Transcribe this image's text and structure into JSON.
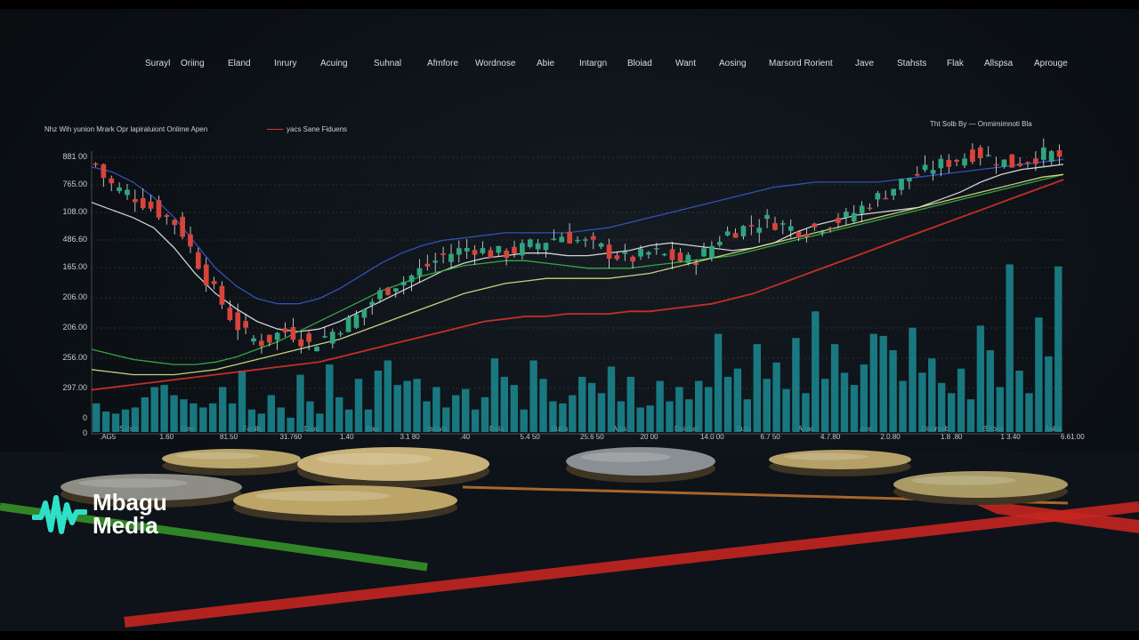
{
  "menu": [
    "Surayl",
    "Oriing",
    "Eland",
    "Inrury",
    "Acuing",
    "Suhnal",
    "Afmfore",
    "Wordnose",
    "Abie",
    "Intargn",
    "Bloiad",
    "Want",
    "Aosing",
    "Marsord Rorient",
    "Jave",
    "Stahsts",
    "Flak",
    "Allspsa",
    "Aprouge"
  ],
  "legend": {
    "left": "Nhz Wih yunion Mrark Opr lapiraluiont Onlime Apen",
    "mid": "yacs Sane Fiduens",
    "right": "Tht Solb By — Onmimimnoti Bla"
  },
  "brand": {
    "line1": "Mbagu",
    "line2": "Media"
  },
  "colors": {
    "background": "#0c1116",
    "up": "#2fa57e",
    "down": "#d8433a",
    "volume": "#1b8a92",
    "ma_white": "#e6e6e6",
    "ma_green": "#3db54a",
    "ma_yellow": "#d9e68a",
    "ma_red": "#d8322a",
    "ma_blue": "#3a56c8",
    "brand": "#2ee0c8"
  },
  "chart_data": {
    "type": "candlestick",
    "title": "",
    "xlabel": "",
    "ylabel": "",
    "y_ticks": [
      "881 00",
      "765.00",
      "108.00",
      "486.60",
      "165.00",
      "206.00",
      "206.00",
      "256.00",
      "297.00",
      "0",
      "0"
    ],
    "x_ticks": [
      ".AG5",
      "1.60",
      "81.50",
      "31.760",
      "1.40",
      "3.1 80",
      ".40",
      "5.4 50",
      "25.6 50",
      "20 00",
      "14.0 00",
      "6.7 50",
      "4.7.80",
      "2.0.80",
      "1.8 .80",
      "1 3.40",
      "6.61.00"
    ],
    "x_ticks_secondary": [
      "Salsts",
      "Gee",
      "Fanils",
      "Daal",
      "Baa",
      "Isswis",
      "Dala",
      "Bullis",
      "Adis",
      "Doisbal",
      "Bulls",
      "Anas",
      "Ans",
      "Dissrsab",
      "Billbas",
      "Anlos"
    ],
    "grid": true,
    "legend_position": "top-left",
    "price_range": [
      0,
      100
    ],
    "close": [
      93,
      88,
      85,
      83,
      82,
      80,
      78,
      76,
      74,
      72,
      70,
      66,
      60,
      54,
      48,
      43,
      38,
      33,
      29,
      26,
      24,
      23,
      24,
      26,
      27,
      26,
      24,
      22,
      23,
      25,
      27,
      29,
      31,
      33,
      36,
      39,
      42,
      44,
      46,
      47,
      49,
      51,
      53,
      55,
      57,
      58,
      59,
      60,
      60,
      59,
      58,
      58,
      58,
      59,
      60,
      61,
      62,
      63,
      64,
      65,
      64,
      63,
      62,
      61,
      60,
      58,
      57,
      56,
      56,
      57,
      58,
      58,
      57,
      56,
      55,
      55,
      56,
      58,
      61,
      64,
      66,
      67,
      68,
      69,
      70,
      71,
      70,
      69,
      68,
      67,
      67,
      68,
      69,
      70,
      71,
      72,
      74,
      76,
      78,
      80,
      82,
      84,
      86,
      88,
      89,
      90,
      92,
      93,
      94,
      95,
      96,
      97,
      97,
      96,
      95,
      94,
      93,
      94,
      95,
      96,
      97,
      97,
      96
    ],
    "series": [
      {
        "values": [
          78,
          75,
          72,
          68,
          60,
          50,
          42,
          36,
          31,
          28,
          27,
          28,
          31,
          35,
          39,
          43,
          47,
          51,
          54,
          56,
          57,
          58,
          58,
          57,
          57,
          58,
          59,
          61,
          62,
          61,
          60,
          59,
          60,
          62,
          66,
          69,
          71,
          73,
          74,
          75,
          76,
          79,
          82,
          86,
          89,
          91,
          92,
          93
        ]
      },
      {
        "values": [
          20,
          18,
          16,
          15,
          14,
          14,
          15,
          17,
          20,
          23,
          27,
          31,
          35,
          39,
          43,
          46,
          49,
          51,
          53,
          54,
          55,
          55,
          54,
          53,
          52,
          52,
          52,
          53,
          54,
          55,
          56,
          57,
          59,
          61,
          63,
          65,
          67,
          69,
          71,
          73,
          75,
          77,
          79,
          81,
          83,
          85,
          87,
          89
        ]
      },
      {
        "values": [
          12,
          11,
          10,
          10,
          10,
          11,
          12,
          14,
          16,
          18,
          20,
          22,
          24,
          27,
          30,
          33,
          36,
          39,
          42,
          44,
          46,
          47,
          48,
          48,
          48,
          48,
          49,
          50,
          52,
          54,
          56,
          58,
          60,
          62,
          64,
          66,
          68,
          70,
          72,
          74,
          76,
          78,
          80,
          82,
          84,
          86,
          88,
          89
        ]
      },
      {
        "values": [
          4,
          5,
          6,
          7,
          8,
          9,
          10,
          11,
          12,
          13,
          14,
          15,
          17,
          19,
          21,
          23,
          25,
          27,
          29,
          31,
          32,
          33,
          33,
          34,
          34,
          34,
          35,
          35,
          36,
          37,
          38,
          40,
          42,
          45,
          48,
          51,
          54,
          57,
          60,
          63,
          66,
          69,
          72,
          75,
          78,
          81,
          84,
          87
        ]
      },
      {
        "values": [
          92,
          90,
          86,
          80,
          72,
          62,
          52,
          45,
          40,
          38,
          38,
          40,
          44,
          49,
          54,
          58,
          61,
          63,
          64,
          65,
          66,
          66,
          66,
          66,
          67,
          68,
          70,
          72,
          74,
          76,
          78,
          80,
          82,
          84,
          85,
          86,
          86,
          86,
          86,
          87,
          88,
          89,
          90,
          91,
          92,
          93,
          94,
          95
        ]
      }
    ],
    "volume": [
      14,
      10,
      9,
      11,
      12,
      17,
      22,
      23,
      18,
      16,
      14,
      12,
      14,
      22,
      14,
      30,
      11,
      9,
      18,
      12,
      7,
      28,
      15,
      9,
      33,
      17,
      11,
      26,
      11,
      30,
      35,
      23,
      25,
      26,
      15,
      22,
      12,
      18,
      21,
      11,
      17,
      36,
      27,
      23,
      11,
      35,
      26,
      15,
      14,
      18,
      27,
      24,
      19,
      32,
      15,
      27,
      12,
      13,
      25,
      15,
      22,
      16,
      25,
      22,
      48,
      27,
      31,
      16,
      43,
      26,
      34,
      21,
      46,
      19,
      59,
      26,
      43,
      29,
      23,
      33,
      48,
      47,
      40,
      25,
      51,
      29,
      36,
      24,
      19,
      31,
      16,
      52,
      40,
      22,
      82,
      30,
      19,
      56,
      37,
      81
    ]
  }
}
